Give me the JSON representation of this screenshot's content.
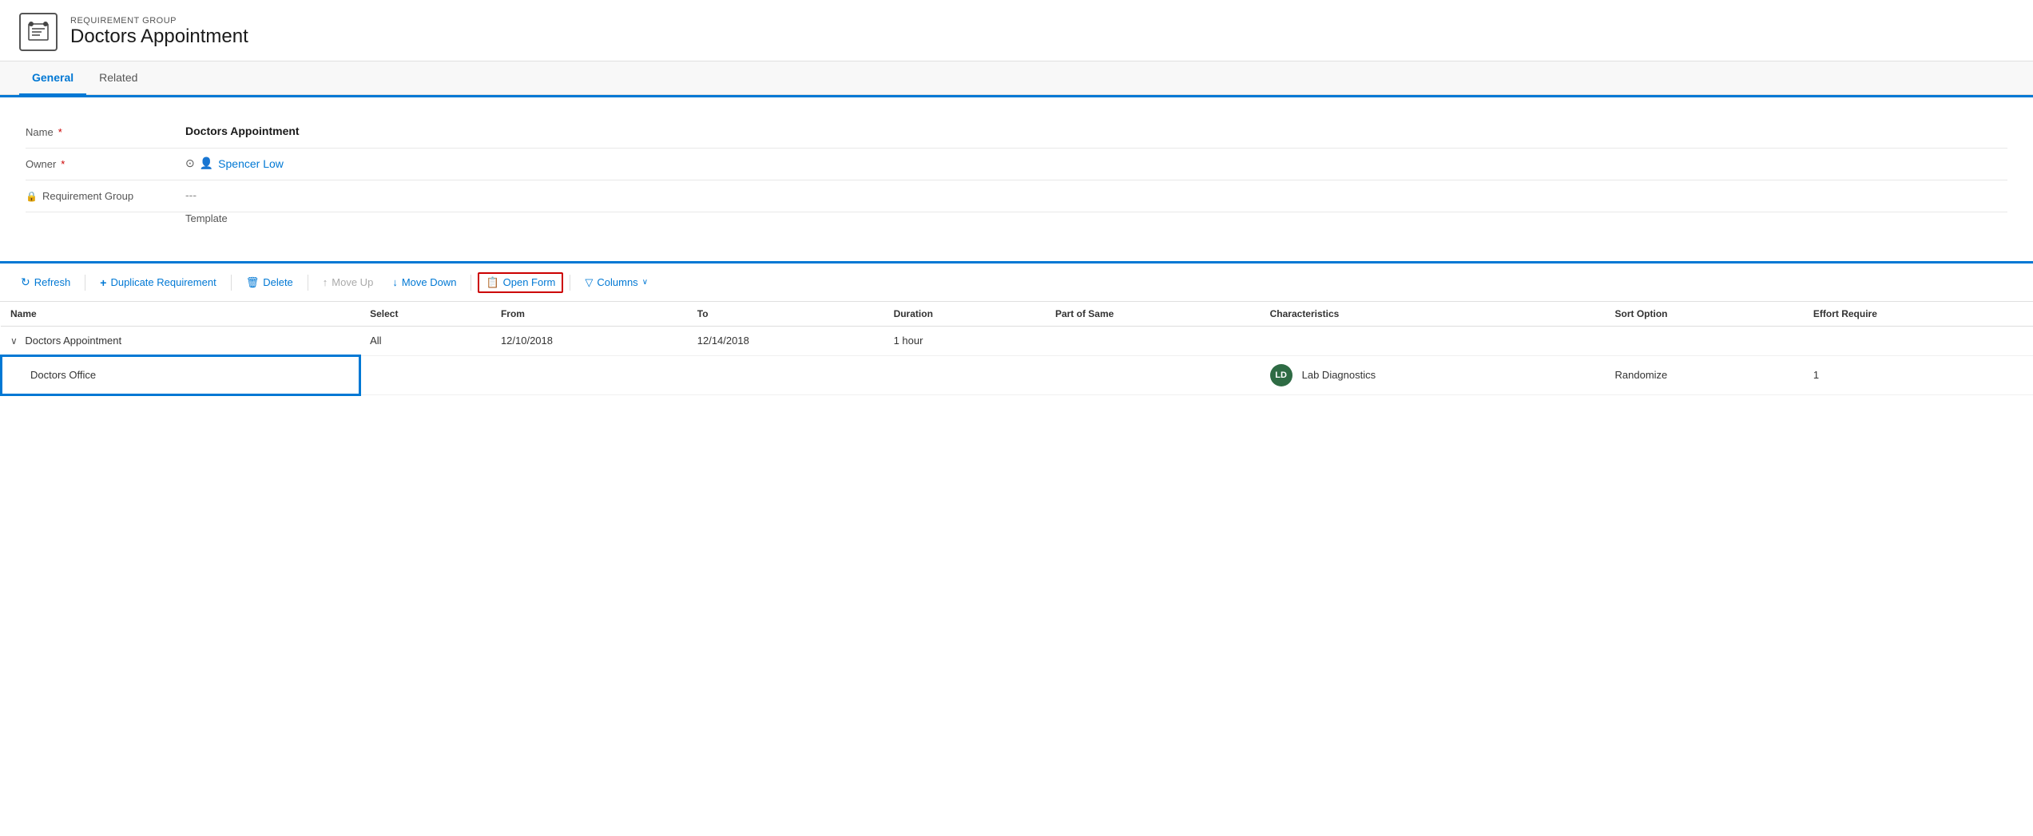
{
  "header": {
    "subtitle": "REQUIREMENT GROUP",
    "title": "Doctors Appointment"
  },
  "tabs": [
    {
      "id": "general",
      "label": "General",
      "active": true
    },
    {
      "id": "related",
      "label": "Related",
      "active": false
    }
  ],
  "form": {
    "fields": [
      {
        "id": "name",
        "label": "Name",
        "required": true,
        "value": "Doctors Appointment",
        "bold": true
      },
      {
        "id": "owner",
        "label": "Owner",
        "required": true,
        "value": "Spencer Low",
        "isLink": true
      },
      {
        "id": "req-group-template",
        "label": "Requirement Group Template",
        "required": false,
        "value": "---",
        "locked": true
      }
    ]
  },
  "toolbar": {
    "buttons": [
      {
        "id": "refresh",
        "icon": "↻",
        "label": "Refresh",
        "disabled": false
      },
      {
        "id": "duplicate",
        "icon": "+",
        "label": "Duplicate Requirement",
        "disabled": false
      },
      {
        "id": "delete",
        "icon": "🗑",
        "label": "Delete",
        "disabled": false
      },
      {
        "id": "move-up",
        "icon": "↑",
        "label": "Move Up",
        "disabled": true
      },
      {
        "id": "move-down",
        "icon": "↓",
        "label": "Move Down",
        "disabled": false
      },
      {
        "id": "open-form",
        "icon": "📋",
        "label": "Open Form",
        "highlighted": true
      },
      {
        "id": "columns",
        "icon": "▽",
        "label": "Columns",
        "disabled": false
      }
    ]
  },
  "table": {
    "columns": [
      {
        "id": "name",
        "label": "Name"
      },
      {
        "id": "select",
        "label": "Select"
      },
      {
        "id": "from",
        "label": "From"
      },
      {
        "id": "to",
        "label": "To"
      },
      {
        "id": "duration",
        "label": "Duration"
      },
      {
        "id": "part-of-same",
        "label": "Part of Same"
      },
      {
        "id": "characteristics",
        "label": "Characteristics"
      },
      {
        "id": "sort-option",
        "label": "Sort Option"
      },
      {
        "id": "effort-required",
        "label": "Effort Require"
      }
    ],
    "rows": [
      {
        "id": "row-1",
        "type": "parent",
        "name": "Doctors Appointment",
        "select": "All",
        "from": "12/10/2018",
        "to": "12/14/2018",
        "duration": "1 hour",
        "partOfSame": "",
        "characteristics": "",
        "sortOption": "",
        "effortRequired": ""
      },
      {
        "id": "row-2",
        "type": "child",
        "name": "Doctors Office",
        "select": "",
        "from": "",
        "to": "",
        "duration": "",
        "partOfSame": "",
        "characteristicsBadge": "LD",
        "characteristicsLabel": "Lab Diagnostics",
        "sortOption": "Randomize",
        "effortRequired": "1",
        "selected": true
      }
    ]
  }
}
